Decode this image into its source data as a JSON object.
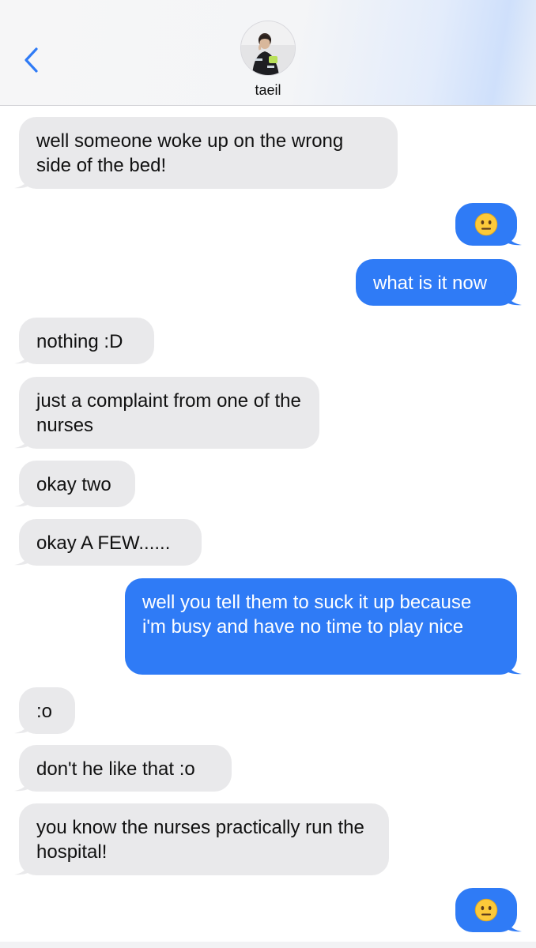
{
  "header": {
    "contact_name": "taeil",
    "back_icon": "chevron-left-icon",
    "accent": "#2f7bf6"
  },
  "colors": {
    "incoming_bubble": "#e9e9eb",
    "outgoing_bubble": "#2f7bf6"
  },
  "messages": [
    {
      "from": "them",
      "text": "well someone woke up on the wrong side of the bed!"
    },
    {
      "from": "me",
      "text": "😐",
      "emoji": "neutral-face"
    },
    {
      "from": "me",
      "text": "what is it now"
    },
    {
      "from": "them",
      "text": "nothing :D"
    },
    {
      "from": "them",
      "text": "just a complaint from one of the nurses"
    },
    {
      "from": "them",
      "text": "okay two"
    },
    {
      "from": "them",
      "text": "okay A FEW......"
    },
    {
      "from": "me",
      "text": "well you tell them to suck it up because i'm busy and have no time to play nice"
    },
    {
      "from": "them",
      "text": ":o"
    },
    {
      "from": "them",
      "text": "don't he like that :o"
    },
    {
      "from": "them",
      "text": "you know the nurses practically run the hospital!"
    },
    {
      "from": "me",
      "text": "😐",
      "emoji": "neutral-face"
    }
  ]
}
